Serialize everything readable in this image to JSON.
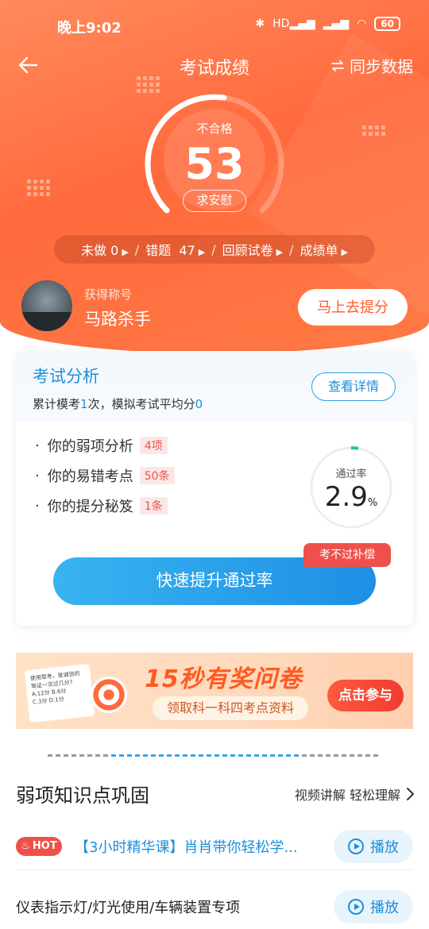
{
  "status": {
    "time": "晚上9:02",
    "network": "HD",
    "battery": "60"
  },
  "nav": {
    "title": "考试成绩",
    "sync_label": "同步数据"
  },
  "score": {
    "result": "不合格",
    "value": "53",
    "comfort_label": "求安慰",
    "progress": 0.53
  },
  "stats": {
    "undone_label": "未做",
    "undone_value": "0",
    "wrong_label": "错题",
    "wrong_value": "47",
    "review_label": "回顾试卷",
    "report_label": "成绩单"
  },
  "profile": {
    "title_label": "获得称号",
    "title_name": "马路杀手",
    "boost_button": "马上去提分"
  },
  "analysis": {
    "title": "考试分析",
    "sub_prefix": "累计模考",
    "sub_count": "1",
    "sub_mid": "次，模拟考试平均分",
    "sub_avg": "0",
    "detail_button": "查看详情",
    "items": [
      {
        "label": "你的弱项分析",
        "tag": "4项"
      },
      {
        "label": "你的易错考点",
        "tag": "50条"
      },
      {
        "label": "你的提分秘笈",
        "tag": "1条"
      }
    ],
    "pass_label": "通过率",
    "pass_value": "2.9",
    "pass_unit": "%",
    "pass_rate": 0.029,
    "badge": "考不过补偿",
    "cta": "快速提升通过率"
  },
  "banner": {
    "title": "15秒有奖问卷",
    "subtitle": "领取科一科四考点资料",
    "button": "点击参与",
    "paper_line1": "使用驾考，是诚信的",
    "paper_line2": "驾证一次过几分?",
    "opt_a": "A.12分",
    "opt_b": "B.6分",
    "opt_c": "C.3分",
    "opt_d": "D.1分"
  },
  "section": {
    "title": "弱项知识点巩固",
    "more": "视频讲解 轻松理解",
    "rows": [
      {
        "hot": "HOT",
        "text": "【3小时精华课】肖肖带你轻松学...",
        "play": "播放"
      },
      {
        "text": "仪表指示灯/灯光使用/车辆装置专项",
        "play": "播放"
      }
    ]
  },
  "colors": {
    "brand_orange": "#ff6a3d",
    "accent_blue": "#1e8fd8",
    "alert_red": "#f0504b"
  }
}
